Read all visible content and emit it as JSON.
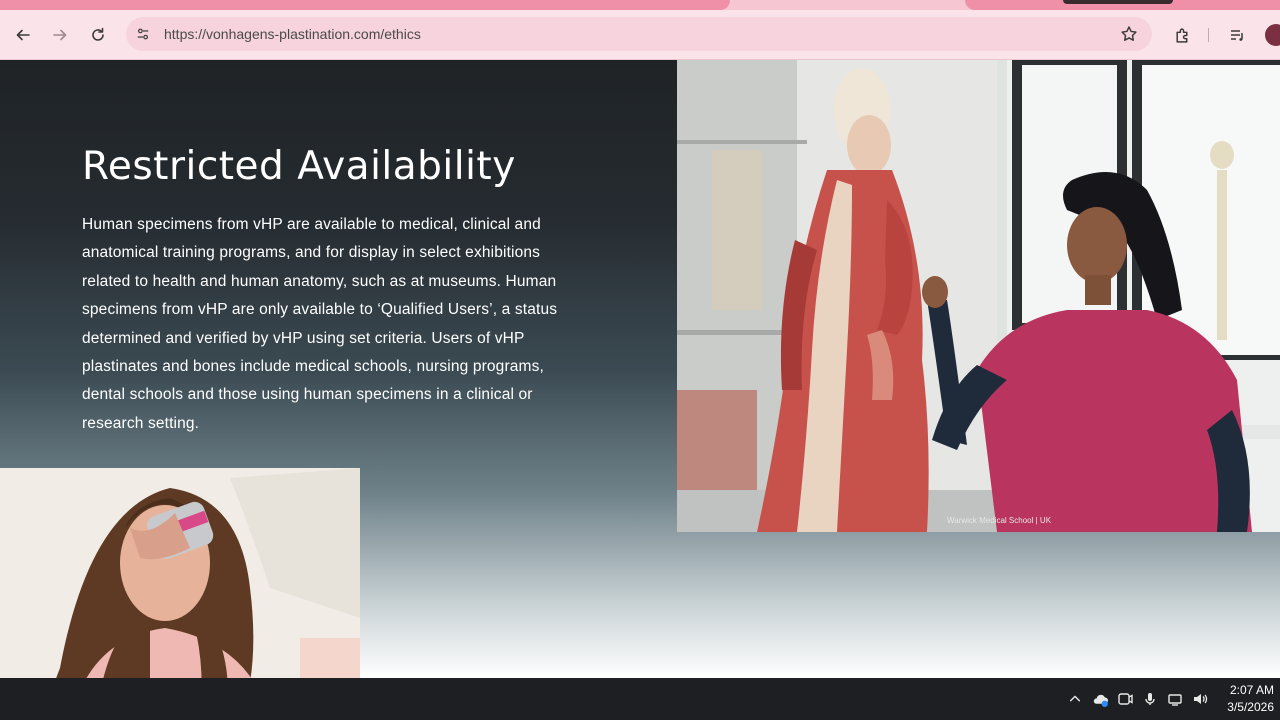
{
  "browser": {
    "url": "https://vonhagens-plastination.com/ethics",
    "icons": [
      "back-icon",
      "forward-icon",
      "reload-icon",
      "site-info-icon",
      "bookmark-star-icon",
      "extensions-icon",
      "media-queue-icon",
      "profile-avatar"
    ]
  },
  "page": {
    "heading": "Restricted Availability",
    "body": "Human specimens from vHP are available to medical, clinical and anatomical training programs, and for display in select exhibitions related to health and human anatomy, such as at museums. Human specimens from vHP are only available to ‘Qualified Users’, a status determined and verified by vHP using set criteria. Users of vHP plastinates and bones include medical schools, nursing programs, dental schools and those using human specimens in a clinical or research setting.",
    "image_caption": "Warwick Medical School | UK"
  },
  "taskbar": {
    "time": "2:07 AM",
    "date": "3/5/2026",
    "tray_icons": [
      "chevron-up-icon",
      "onedrive-icon",
      "teams-icon",
      "microphone-icon",
      "network-icon",
      "volume-icon"
    ]
  },
  "colors": {
    "chrome_bg": "#fbe3ea",
    "omnibox_bg": "#f6d3dd",
    "scrub_pink": "#c2416a",
    "page_dark": "#1f2326"
  }
}
